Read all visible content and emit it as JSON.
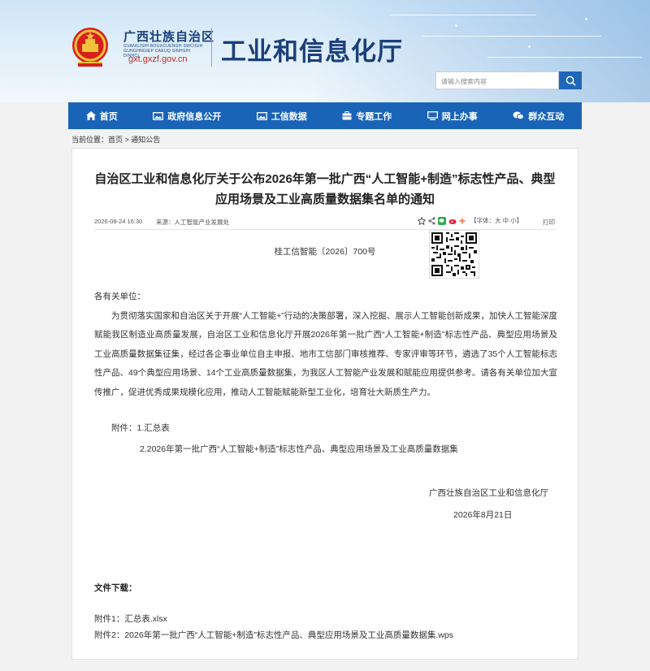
{
  "header": {
    "region_name": "广西壮族自治区",
    "region_name_zhuang": "GVANGJSIH BOUXCUENGH SWCIGIH GUNGHNGIEP CAEUQ SINHSIH DINHCI",
    "domain": "gxt.gxzf.gov.cn",
    "dept_name": "工业和信息化厅",
    "colors": {
      "brand_blue": "#1a64b7",
      "title_blue": "#1a3f7a",
      "domain_red": "#c12a1b"
    }
  },
  "search": {
    "placeholder": "请输入搜索内容",
    "icon": "search-icon"
  },
  "nav": {
    "items": [
      {
        "label": "首页",
        "icon": "home-icon"
      },
      {
        "label": "政府信息公开",
        "icon": "image-icon"
      },
      {
        "label": "工信数据",
        "icon": "image-icon"
      },
      {
        "label": "专题工作",
        "icon": "briefcase-icon"
      },
      {
        "label": "网上办事",
        "icon": "monitor-icon"
      },
      {
        "label": "群众互动",
        "icon": "chat-icon"
      }
    ]
  },
  "breadcrumb": "当前位置：首页 > 通知公告",
  "article": {
    "title": "自治区工业和信息化厅关于公布2026年第一批广西“人工智能+制造”标志性产品、典型应用场景及工业高质量数据集名单的通知",
    "date": "2026-08-24 16:30",
    "source": "来源：人工智能产业发展处",
    "font_size_label": "【字体：大 中 小】",
    "print_label": "打印",
    "doc_number": "桂工信智能〔2026〕700号",
    "salutation": "各有关单位：",
    "body": "为贯彻落实国家和自治区关于开展“人工智能+”行动的决策部署，深入挖掘、展示人工智能创新成果，加快人工智能深度赋能我区制造业高质量发展，自治区工业和信息化厅开展2026年第一批广西“人工智能+制造”标志性产品、典型应用场景及工业高质量数据集征集，经过各企事业单位自主申报、地市工信部门审核推荐、专家评审等环节，遴选了35个人工智能标志性产品、49个典型应用场景、14个工业高质量数据集，为我区人工智能产业发展和赋能应用提供参考。请各有关单位加大宣传推广，促进优秀成果规模化应用，推动人工智能赋能新型工业化，培育壮大新质生产力。",
    "attachment_1": "附件：1.汇总表",
    "attachment_2": "2.2026年第一批广西“人工智能+制造”标志性产品、典型应用场景及工业高质量数据集",
    "sign_org": "广西壮族自治区工业和信息化厅",
    "sign_date": "2026年8月21日"
  },
  "downloads": {
    "title": "文件下载：",
    "items": [
      "附件1：汇总表.xlsx",
      "附件2：2026年第一批广西“人工智能+制造”标志性产品、典型应用场景及工业高质量数据集.wps"
    ]
  }
}
